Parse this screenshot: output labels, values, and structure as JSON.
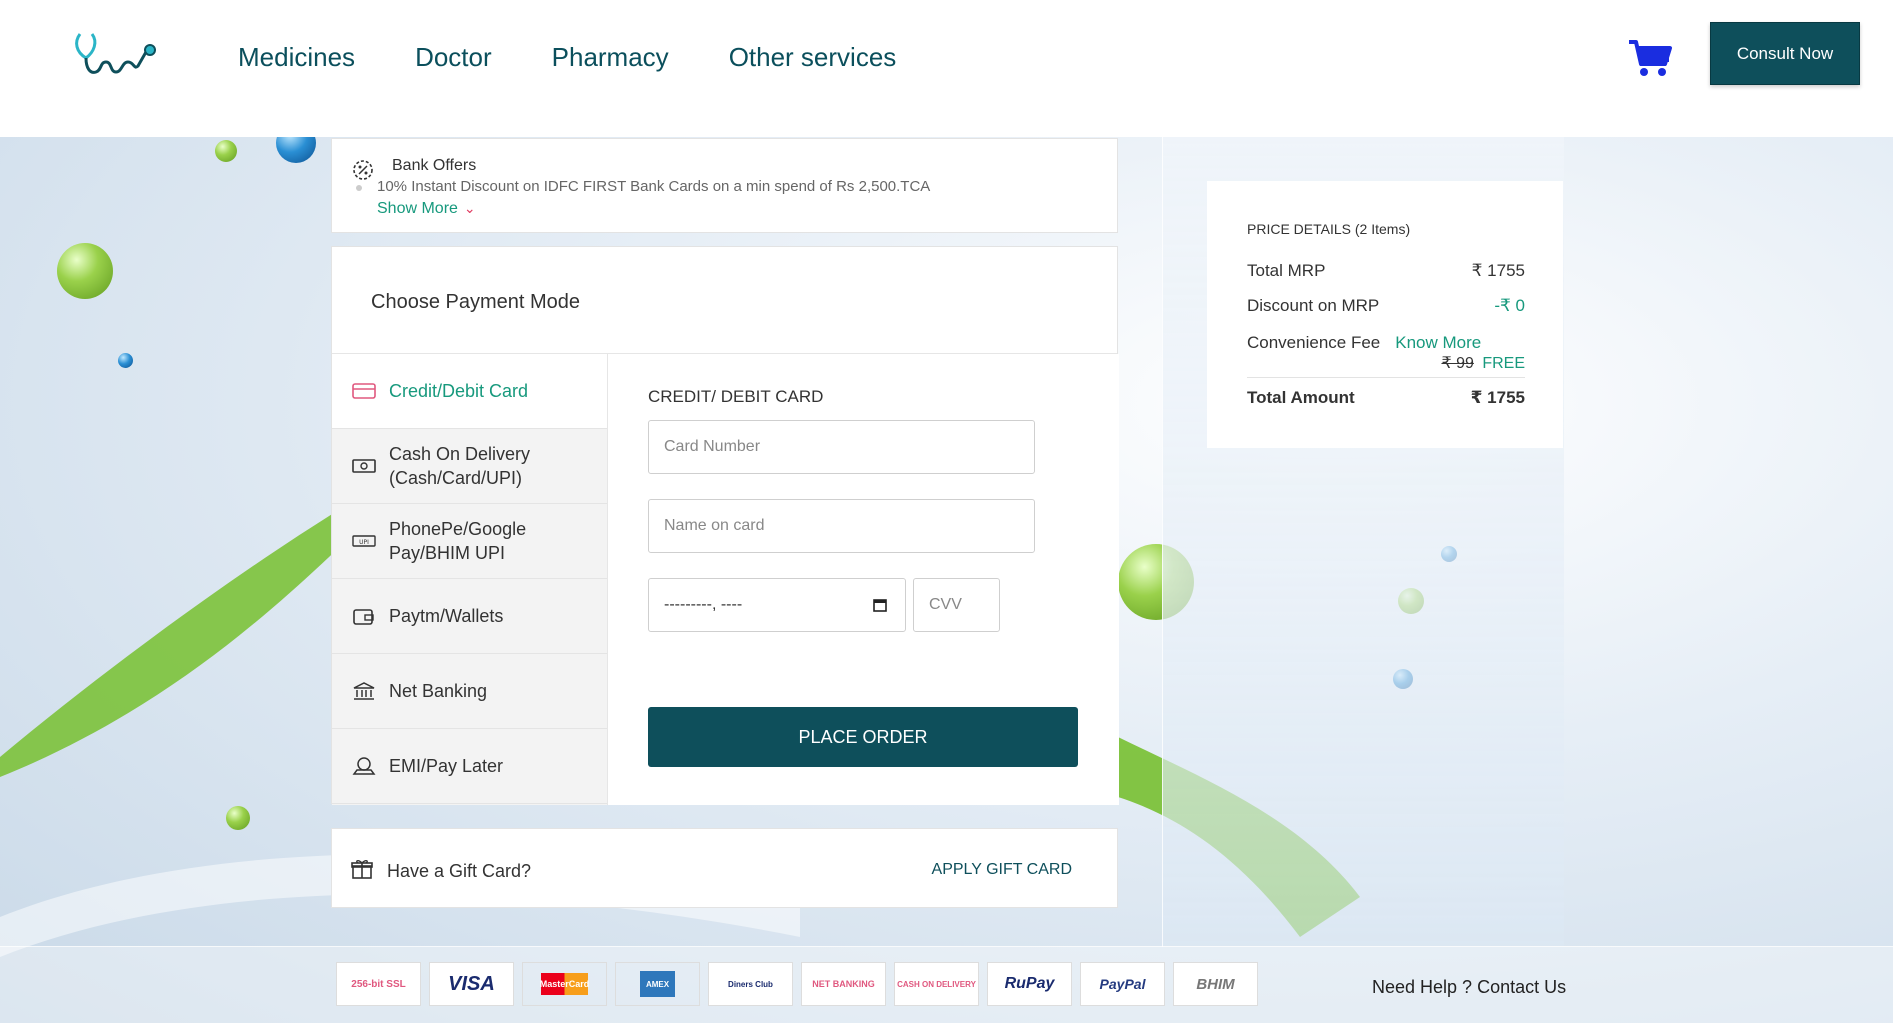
{
  "header": {
    "nav": [
      "Medicines",
      "Doctor",
      "Pharmacy",
      "Other services"
    ],
    "consult_label": "Consult Now"
  },
  "offers": {
    "title": "Bank Offers",
    "text": "10% Instant Discount on IDFC FIRST Bank Cards on a min spend of Rs 2,500.TCA",
    "show_more": "Show More"
  },
  "payment": {
    "title": "Choose Payment Mode",
    "methods": [
      {
        "label": "Credit/Debit Card",
        "icon": "credit-card-icon",
        "active": true
      },
      {
        "label": "Cash On Delivery (Cash/Card/UPI)",
        "icon": "cash-icon",
        "active": false
      },
      {
        "label": "PhonePe/Google Pay/BHIM UPI",
        "icon": "upi-icon",
        "active": false
      },
      {
        "label": "Paytm/Wallets",
        "icon": "wallet-icon",
        "active": false
      },
      {
        "label": "Net Banking",
        "icon": "bank-icon",
        "active": false
      },
      {
        "label": "EMI/Pay Later",
        "icon": "emi-icon",
        "active": false
      }
    ],
    "form": {
      "title": "CREDIT/ DEBIT CARD",
      "card_number_placeholder": "Card Number",
      "name_placeholder": "Name on card",
      "expiry_value": "---------, ----",
      "cvv_placeholder": "CVV",
      "place_order": "PLACE ORDER"
    }
  },
  "gift": {
    "label": "Have a Gift Card?",
    "apply": "APPLY GIFT CARD"
  },
  "price": {
    "title": "PRICE DETAILS (2 Items)",
    "total_mrp_label": "Total MRP",
    "total_mrp": "₹ 1755",
    "discount_label": "Discount on MRP",
    "discount": "-₹ 0",
    "fee_label": "Convenience Fee",
    "know_more": "Know More",
    "fee_strike": "₹ 99",
    "fee_free": "FREE",
    "total_label": "Total Amount",
    "total": "₹ 1755"
  },
  "footer": {
    "logos": [
      "256-bit SSL",
      "VISA",
      "MasterCard",
      "AMEX",
      "Diners Club",
      "NET BANKING",
      "CASH ON DELIVERY",
      "RuPay",
      "PayPal",
      "BHIM"
    ],
    "help": "Need Help ? Contact Us"
  },
  "colors": {
    "primary": "#0e4f5b",
    "accent": "#17997d",
    "cart": "#1a2de0"
  }
}
